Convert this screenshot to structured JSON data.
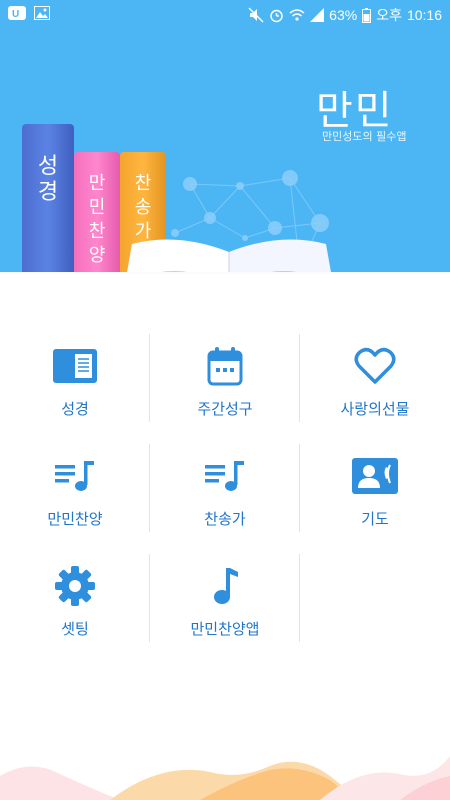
{
  "status_bar": {
    "battery_percent": "63%",
    "ampm": "오후",
    "time": "10:16",
    "bg_color": "#4cb6f5"
  },
  "hero": {
    "title": "만민",
    "subtitle": "만민성도의 필수앱",
    "books": [
      {
        "text": [
          "성",
          "경"
        ],
        "color": "#4f72d4"
      },
      {
        "text": [
          "만",
          "민",
          "찬",
          "양"
        ],
        "color": "#ff7ec8"
      },
      {
        "text": [
          "찬",
          "송",
          "가"
        ],
        "color": "#f8a52c"
      }
    ]
  },
  "menu": {
    "accent_color": "#2f8fdc",
    "items": [
      {
        "label": "성경",
        "icon": "bible-icon"
      },
      {
        "label": "주간성구",
        "icon": "calendar-icon"
      },
      {
        "label": "사랑의선물",
        "icon": "heart-icon"
      },
      {
        "label": "만민찬양",
        "icon": "music-list-icon"
      },
      {
        "label": "찬송가",
        "icon": "music-list-icon"
      },
      {
        "label": "기도",
        "icon": "prayer-contact-icon"
      },
      {
        "label": "셋팅",
        "icon": "gear-icon"
      },
      {
        "label": "만민찬양앱",
        "icon": "music-note-icon"
      }
    ]
  }
}
